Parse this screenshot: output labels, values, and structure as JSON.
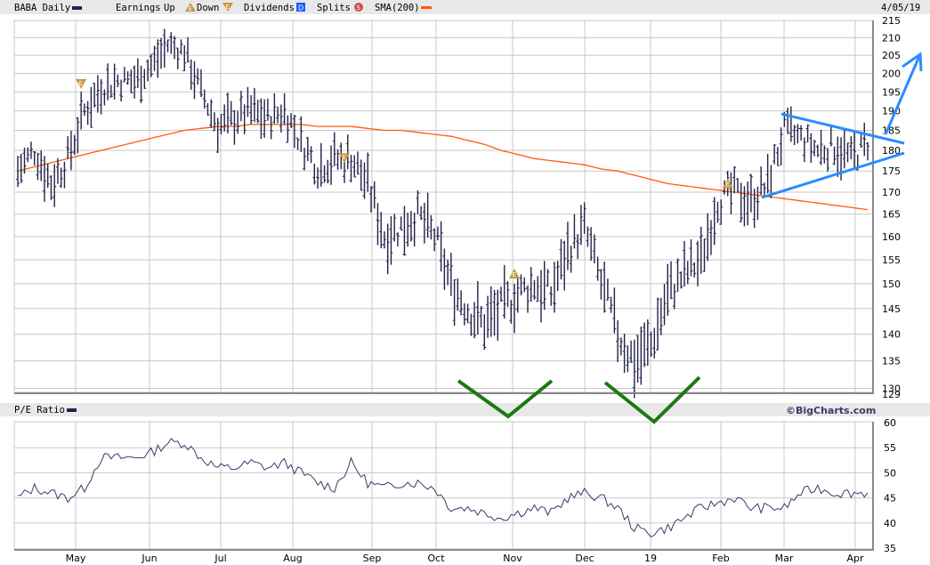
{
  "header": {
    "symbol_label": "BABA Daily",
    "earnings_label": "Earnings",
    "up_label": "Up",
    "down_label": "Down",
    "dividends_label": "Dividends",
    "dividend_icon_letter": "D",
    "splits_label": "Splits",
    "split_icon_letter": "S",
    "sma_label": "SMA(200)",
    "earnings_icon_letter": "E",
    "date": "4/05/19"
  },
  "lower_header": {
    "pe_label": "P/E Ratio",
    "brand": "©BigCharts.com"
  },
  "colors": {
    "price": "#22224a",
    "sma": "#ff5a0a",
    "grid": "#c8c8c8",
    "band": "#e8e8e8",
    "earnings": "#c8963c",
    "dividend": "#1a5cff",
    "split": "#c85050",
    "annot_green": "#1a7a10",
    "annot_blue": "#2a8cff"
  },
  "chart_data": [
    {
      "type": "bar",
      "subtype": "ohlc",
      "title": "BABA Daily",
      "scale": "log",
      "ylim": [
        129,
        215
      ],
      "yticks": [
        215,
        210,
        205,
        200,
        195,
        190,
        185,
        180,
        175,
        170,
        165,
        160,
        155,
        150,
        145,
        140,
        135,
        130,
        129
      ],
      "x_tick_labels": [
        "May",
        "Jun",
        "Jul",
        "Aug",
        "Sep",
        "Oct",
        "Nov",
        "Dec",
        "19",
        "Feb",
        "Mar",
        "Apr"
      ],
      "x_range": [
        "2018-04-09",
        "2019-04-05"
      ],
      "weekly_price": [
        175,
        180,
        172,
        178,
        190,
        196,
        198,
        198,
        202,
        208,
        206,
        195,
        186,
        188,
        190,
        188,
        190,
        182,
        176,
        178,
        178,
        172,
        160,
        162,
        165,
        160,
        150,
        145,
        142,
        145,
        148,
        150,
        148,
        157,
        162,
        150,
        140,
        135,
        138,
        148,
        152,
        155,
        168,
        170,
        168,
        172,
        185,
        183,
        180,
        181,
        178,
        182
      ],
      "sma200_weekly": [
        175,
        176,
        177,
        178,
        179,
        180,
        181,
        182,
        183,
        184,
        185,
        185.5,
        186,
        186,
        186.5,
        186.5,
        186.5,
        186.5,
        186,
        186,
        186,
        185.5,
        185,
        185,
        184.5,
        184,
        183.5,
        182.5,
        181.5,
        180,
        179,
        178,
        177.5,
        177,
        176.5,
        175.5,
        175,
        174,
        173,
        172,
        171.5,
        171,
        170.5,
        170,
        169.5,
        169,
        168.5,
        168,
        167.5,
        167,
        166.5,
        166
      ],
      "earnings_events": [
        {
          "week": 3.8,
          "type": "down",
          "price": 197
        },
        {
          "week": 19.6,
          "type": "down",
          "price": 178
        },
        {
          "week": 29.8,
          "type": "up",
          "price": 152
        },
        {
          "week": 42.6,
          "type": "up",
          "price": 172
        }
      ]
    },
    {
      "type": "line",
      "title": "P/E Ratio",
      "ylim": [
        35,
        60
      ],
      "yticks": [
        60,
        55,
        50,
        45,
        40,
        35
      ],
      "weekly_pe": [
        45,
        47,
        46,
        45,
        47,
        53,
        53,
        53,
        54,
        56,
        56,
        53,
        51,
        51,
        52,
        51,
        52,
        50,
        48,
        47,
        52,
        48,
        47,
        48,
        48,
        47,
        43,
        43,
        42,
        41,
        42,
        43,
        42,
        45,
        46,
        45,
        43,
        39,
        38,
        39,
        41,
        43,
        44,
        45,
        43,
        43,
        43,
        46,
        47,
        46,
        46,
        46
      ]
    }
  ]
}
